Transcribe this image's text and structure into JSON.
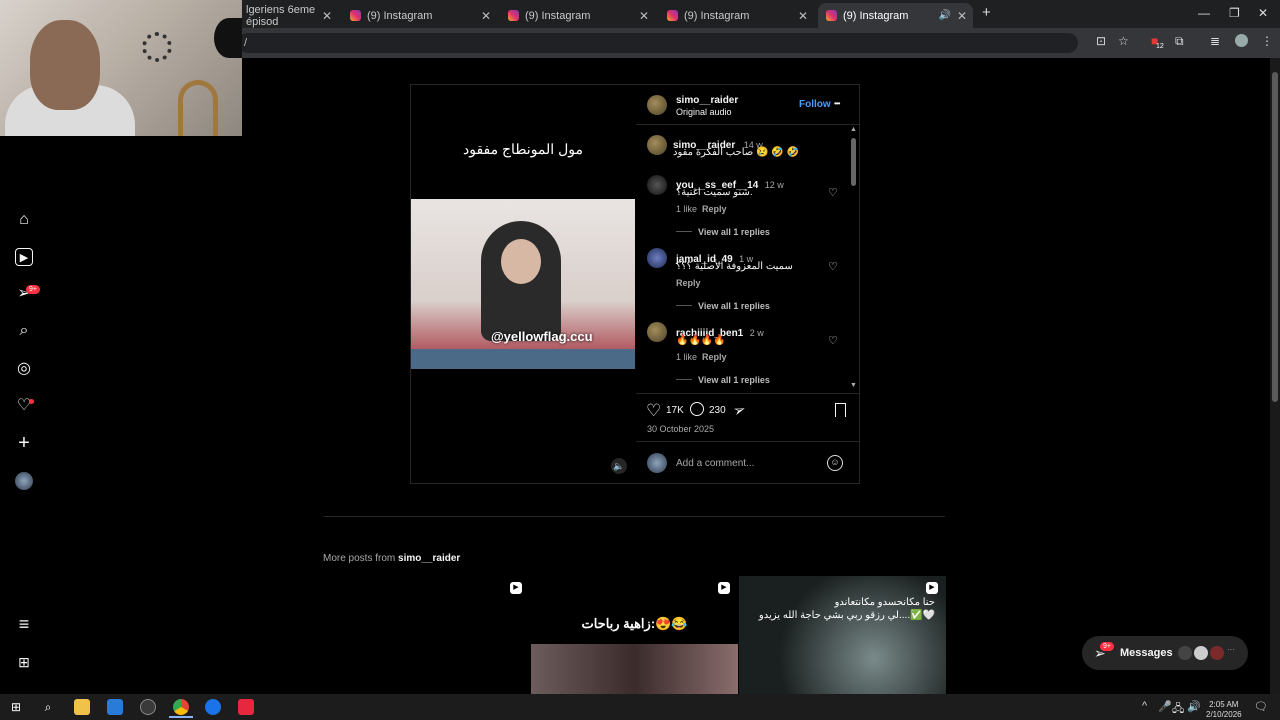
{
  "browser": {
    "tabs": [
      {
        "title": "lgeriens 6eme épisod",
        "active": false
      },
      {
        "title": "(9) Instagram",
        "active": false
      },
      {
        "title": "(9) Instagram",
        "active": false
      },
      {
        "title": "(9) Instagram",
        "active": false
      },
      {
        "title": "(9) Instagram",
        "active": true
      }
    ],
    "new_tab": "+",
    "window_controls": {
      "minimize": "—",
      "restore": "❐",
      "close": "✕"
    },
    "address_fragment": "/",
    "extensions_badge": "12"
  },
  "sidebar": {
    "items": [
      {
        "name": "home",
        "glyph": "⌂"
      },
      {
        "name": "reels",
        "glyph": "▶"
      },
      {
        "name": "messages",
        "glyph": "➢",
        "badge": "9+"
      },
      {
        "name": "search",
        "glyph": "⌕"
      },
      {
        "name": "explore",
        "glyph": "◎"
      },
      {
        "name": "notifications",
        "glyph": "♡"
      },
      {
        "name": "create",
        "glyph": "+"
      },
      {
        "name": "profile",
        "glyph": "●"
      }
    ],
    "more_glyph": "≡",
    "threads_glyph": "⊞"
  },
  "post": {
    "video_caption": "مول المونطاج مفقود",
    "watermark": "@yellowflag.ccu",
    "author": "simo__raider",
    "audio": "Original audio",
    "follow_label": "Follow",
    "options_glyph": "•••",
    "caption": {
      "user": "simo__raider",
      "time": "14 w",
      "text": "صاحب الفكرة مقود 😢 🤣 🤣"
    },
    "comments": [
      {
        "user": "you__ss_eef__14",
        "time": "12 w",
        "text": "شنو سميت اغنية؟.",
        "likes": "1 like",
        "reply": "Reply",
        "view_replies": "View all 1 replies"
      },
      {
        "user": "jamal_id_49",
        "time": "1 w",
        "text": "سميت المعزوفة الأصلية ؟؟؟",
        "likes": "",
        "reply": "Reply",
        "view_replies": "View all 1 replies"
      },
      {
        "user": "rachiiiid_ben1",
        "time": "2 w",
        "text": "🔥🔥🔥🔥",
        "likes": "1 like",
        "reply": "Reply",
        "view_replies": "View all 1 replies"
      }
    ],
    "like_count": "17K",
    "comment_count": "230",
    "date": "30 October 2025",
    "add_comment_placeholder": "Add a comment..."
  },
  "more_posts": {
    "label_prefix": "More posts from",
    "user": "simo__raider",
    "thumbs": [
      {
        "caption": ""
      },
      {
        "caption": "زاهية رباحات:😍😂"
      },
      {
        "caption": "حنا مكانحسدو مكانتعاندو\nلي رزقو ربي بشي حاجة الله يزيدو....✅🤍"
      }
    ]
  },
  "messages_pill": {
    "label": "Messages",
    "badge": "9+"
  },
  "taskbar": {
    "time": "2:05 AM",
    "date": "2/10/2026"
  }
}
